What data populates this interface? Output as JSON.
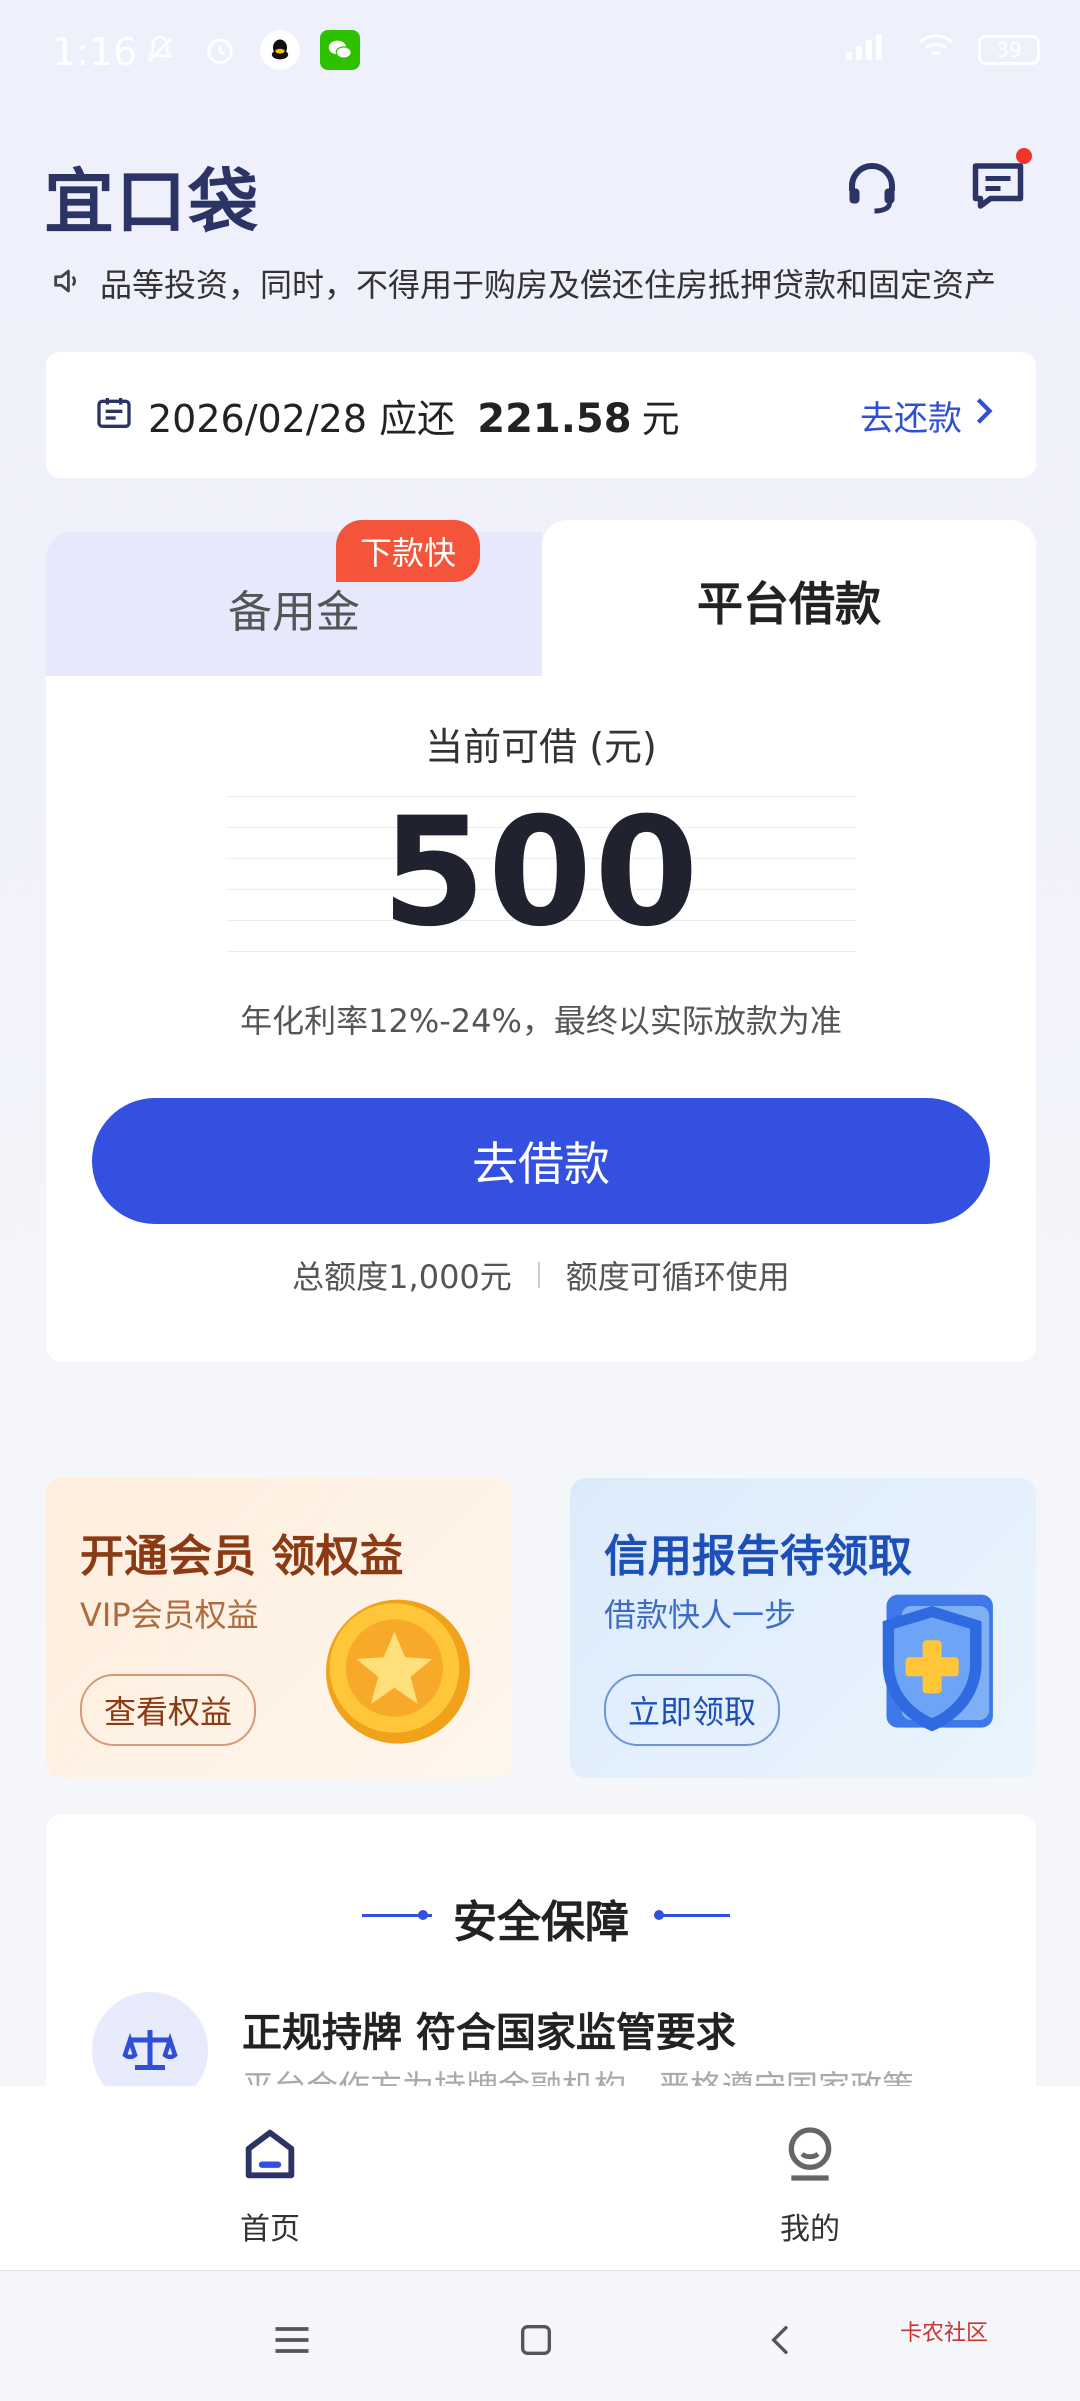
{
  "status_bar": {
    "time": "1:16",
    "battery": "39"
  },
  "header": {
    "logo": "宜口袋",
    "icons": [
      "headset-icon",
      "message-icon"
    ]
  },
  "notice": {
    "text": "品等投资，同时，不得用于购房及偿还住房抵押贷款和固定资产"
  },
  "repay": {
    "date": "2026/02/28",
    "due_label": "应还",
    "amount": "221.58",
    "unit": "元",
    "link": "去还款"
  },
  "loan": {
    "tabs": [
      {
        "label": "备用金"
      },
      {
        "label": "平台借款"
      }
    ],
    "badge": "下款快",
    "available_label": "当前可借 (元)",
    "available_amount": "500",
    "rate_text": "年化利率12%-24%，最终以实际放款为准",
    "button": "去借款",
    "total_limit": "总额度1,000元",
    "cyclic": "额度可循环使用"
  },
  "promos": [
    {
      "title": "开通会员 领权益",
      "subtitle": "VIP会员权益",
      "button": "查看权益"
    },
    {
      "title": "信用报告待领取",
      "subtitle": "借款快人一步",
      "button": "立即领取"
    }
  ],
  "security": {
    "title": "安全保障",
    "item_title": "正规持牌 符合国家监管要求",
    "item_desc": "平台合作方为持牌金融机构，严格遵守国家政策"
  },
  "bottom_nav": [
    {
      "label": "首页"
    },
    {
      "label": "我的"
    }
  ],
  "watermark": "卡农社区",
  "colors": {
    "primary": "#3450e0",
    "badge": "#f4553a",
    "logo": "#2b3464"
  }
}
